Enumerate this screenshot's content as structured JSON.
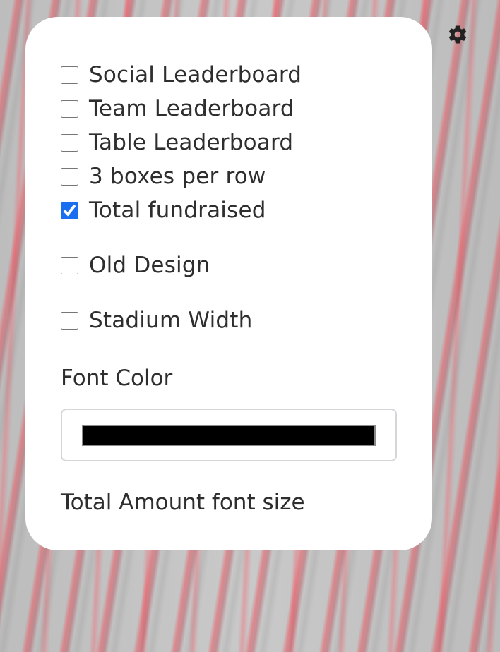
{
  "settings_icon": "gear-icon",
  "options": {
    "social_leaderboard": {
      "label": "Social Leaderboard",
      "checked": false
    },
    "team_leaderboard": {
      "label": "Team Leaderboard",
      "checked": false
    },
    "table_leaderboard": {
      "label": "Table Leaderboard",
      "checked": false
    },
    "boxes_per_row": {
      "label": "3 boxes per row",
      "checked": false
    },
    "total_fundraised": {
      "label": "Total fundraised",
      "checked": true
    },
    "old_design": {
      "label": "Old Design",
      "checked": false
    },
    "stadium_width": {
      "label": "Stadium Width",
      "checked": false
    }
  },
  "font_color": {
    "label": "Font Color",
    "value": "#000000"
  },
  "total_amount_font_size": {
    "label": "Total Amount font size"
  },
  "colors": {
    "checkbox_accent": "#1a6ff0",
    "panel_background": "#ffffff",
    "gear": "#222222"
  }
}
